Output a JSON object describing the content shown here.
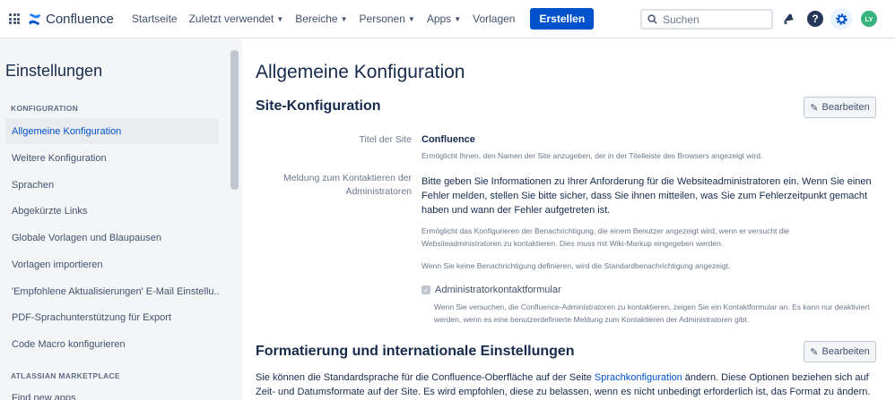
{
  "topbar": {
    "app_name": "Confluence",
    "nav": [
      {
        "label": "Startseite",
        "dropdown": false
      },
      {
        "label": "Zuletzt verwendet",
        "dropdown": true
      },
      {
        "label": "Bereiche",
        "dropdown": true
      },
      {
        "label": "Personen",
        "dropdown": true
      },
      {
        "label": "Apps",
        "dropdown": true
      },
      {
        "label": "Vorlagen",
        "dropdown": false
      }
    ],
    "create_label": "Erstellen",
    "search_placeholder": "Suchen",
    "avatar_initials": "LY",
    "colors": {
      "brand": "#0052cc",
      "avatar": "#36b37e"
    }
  },
  "sidebar": {
    "title": "Einstellungen",
    "section_config": "KONFIGURATION",
    "items": [
      {
        "label": "Allgemeine Konfiguration",
        "active": true
      },
      {
        "label": "Weitere Konfiguration",
        "active": false
      },
      {
        "label": "Sprachen",
        "active": false
      },
      {
        "label": "Abgekürzte Links",
        "active": false
      },
      {
        "label": "Globale Vorlagen und Blaupausen",
        "active": false
      },
      {
        "label": "Vorlagen importieren",
        "active": false
      },
      {
        "label": "'Empfohlene Aktualisierungen' E-Mail Einstellu...",
        "active": false
      },
      {
        "label": "PDF-Sprachunterstützung für Export",
        "active": false
      },
      {
        "label": "Code Macro konfigurieren",
        "active": false
      }
    ],
    "section_marketplace": "ATLASSIAN MARKETPLACE",
    "marketplace_items": [
      {
        "label": "Find new apps"
      }
    ]
  },
  "main": {
    "page_title": "Allgemeine Konfiguration",
    "site_config": {
      "heading": "Site-Konfiguration",
      "edit_label": "Bearbeiten",
      "title_label": "Titel der Site",
      "title_value": "Confluence",
      "title_desc": "Ermöglicht Ihnen, den Namen der Site anzugeben, der in der Titelleiste des Browsers angezeigt wird.",
      "contact_label_line1": "Meldung zum Kontaktieren der",
      "contact_label_line2": "Administratoren",
      "contact_value": "Bitte geben Sie Informationen zu Ihrer Anforderung für die Websiteadministratoren ein. Wenn Sie einen Fehler melden, stellen Sie bitte sicher, dass Sie ihnen mitteilen, was Sie zum Fehlerzeitpunkt gemacht haben und wann der Fehler aufgetreten ist.",
      "contact_desc": "Ermöglicht das Konfigurieren der Benachrichtigung, die einem Benutzer angezeigt wird, wenn er versucht die Websiteadministratoren zu kontaktieren. Dies muss mit Wiki-Markup eingegeben werden.",
      "contact_desc2": "Wenn Sie keine Benachrichtigung definieren, wird die Standardbenachrichtigung angezeigt.",
      "checkbox_label": "Administratorkontaktformular",
      "checkbox_checked": true,
      "checkbox_desc": "Wenn Sie versuchen, die Confluence-Administratoren zu kontaktieren, zeigen Sie ein Kontaktformular an. Es kann nur deaktiviert werden, wenn es eine benutzerdefinierte Meldung zum Kontaktieren der Administratoren gibt."
    },
    "format_section": {
      "heading": "Formatierung und internationale Einstellungen",
      "edit_label": "Bearbeiten",
      "para_before": "Sie können die Standardsprache für die Confluence-Oberfläche auf der Seite ",
      "para_link": "Sprachkonfiguration",
      "para_after": " ändern. Diese Optionen beziehen sich auf Zeit- und Datumsformate auf der Site. Es wird empfohlen, diese zu belassen, wenn es nicht unbedingt erforderlich ist, das Format zu ändern."
    }
  }
}
